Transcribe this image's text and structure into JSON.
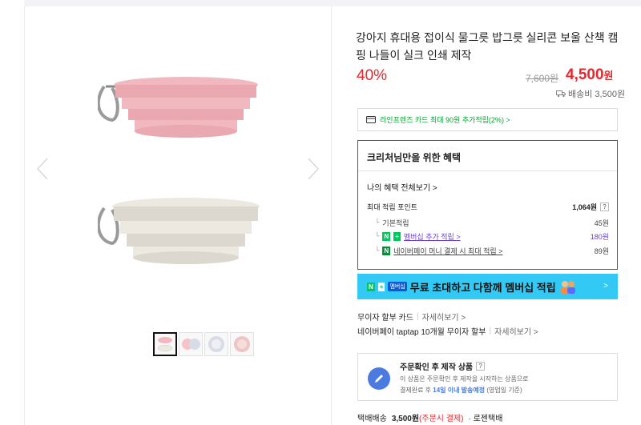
{
  "product": {
    "title": "강아지 휴대용 접이식 물그릇 밥그릇 실리콘 보울 산책 캠핑 나들이 실크 인쇄 제작",
    "discount": "40%",
    "original_price": "7,600원",
    "sale_price": "4,500",
    "sale_unit": "원",
    "shipping_fee": "배송비 3,500원"
  },
  "gallery": {
    "bowl_top_color": "#f2b8bf",
    "bowl_bottom_color": "#ece9e1",
    "thumbnail_colors": [
      "#f5c4c9",
      "#d9c9e4",
      "#d7dce6",
      "#efc4c4"
    ]
  },
  "card_promo": "라인프렌즈 카드 최대 90원 추가적립(2%) >",
  "benefits": {
    "heading": "크리처님만을 위한 혜택",
    "all_link": "나의 혜택 전체보기 >",
    "max_points_label": "최대 적립 포인트",
    "max_points_value": "1,064원",
    "help": "?",
    "basic_label": "기본적립",
    "basic_value": "45원",
    "member_label": "멤버십 추가 적립 >",
    "member_value": "180원",
    "npay_label": "네이버페이 머니 결제 시 최대 적립 >",
    "npay_value": "89원",
    "badge_n": "N",
    "badge_plus": "+"
  },
  "banner": {
    "badge_n": "N",
    "badge_plus": "+",
    "badge_mem": "멤버십",
    "text": "무료 초대하고 다함께 멤버십 적립",
    "chevron": ">"
  },
  "installments": {
    "row1_label": "무이자 할부 카드",
    "row1_link": "자세히보기 >",
    "row2_label": "네이버페이 taptap 10개월 무이자 할부",
    "row2_link": "자세히보기 >",
    "sep": "|"
  },
  "made_to_order": {
    "title": "주문확인 후 제작 상품",
    "help": "?",
    "desc1": "이 상품은 주문확인 후 제작을 시작하는 상품으로",
    "desc2_prefix": "결제완료 후 ",
    "desc2_highlight": "14일 이내 발송예정",
    "desc2_suffix": " (영업일 기준)"
  },
  "delivery": {
    "label": "택배배송",
    "fee": "3,500원",
    "condition": "(주문시 결제)",
    "carrier": "· 로젠택배"
  }
}
